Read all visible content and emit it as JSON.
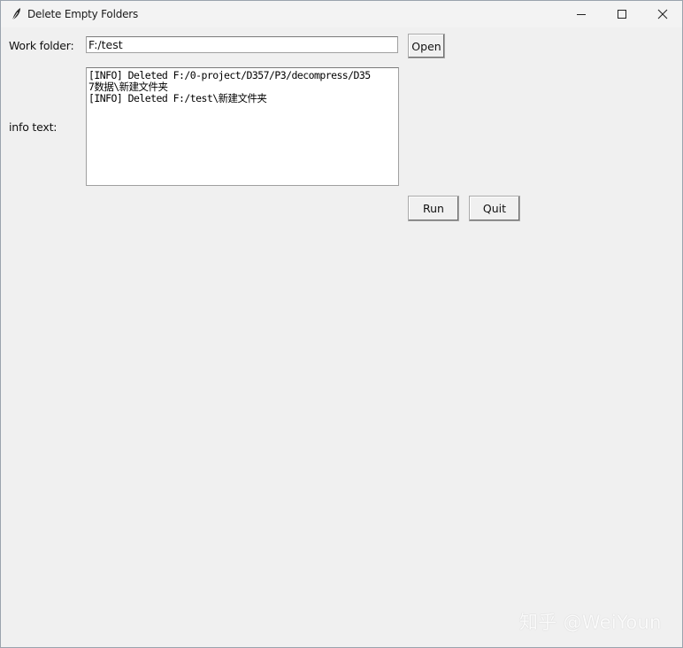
{
  "window": {
    "title": "Delete Empty Folders",
    "icon": "feather-icon",
    "controls": [
      "minimize-icon",
      "maximize-icon",
      "close-icon"
    ]
  },
  "form": {
    "work_folder_label": "Work folder:",
    "work_folder_value": "F:/test",
    "open_button": "Open",
    "info_label": "info text:",
    "log_lines": [
      "[INFO] Deleted F:/0-project/D357/P3/decompress/D35",
      "7数据\\新建文件夹",
      "[INFO] Deleted F:/test\\新建文件夹"
    ],
    "run_button": "Run",
    "quit_button": "Quit"
  },
  "watermark": "知乎 @WeiYoun"
}
